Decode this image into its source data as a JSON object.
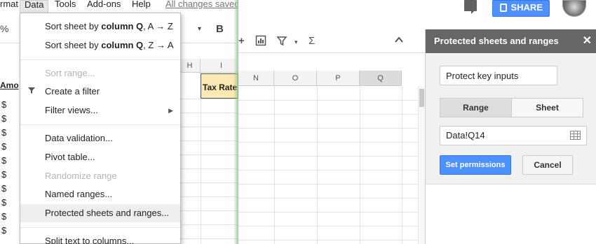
{
  "menubar": {
    "items": [
      "rmat",
      "Data",
      "Tools",
      "Add-ons",
      "Help"
    ],
    "saved_status": "All changes saved"
  },
  "toolbar_left": {
    "percent": "%",
    "dropdown_caret": "▾",
    "bold": "B"
  },
  "left_sheet": {
    "columns": [
      "H",
      "I"
    ],
    "amount_header": "Amo",
    "tax_rate_label": "Tax Rate",
    "dollar_cells": [
      "$",
      "$",
      "$",
      "$",
      "$",
      "$",
      "$",
      "$",
      "$",
      "$"
    ]
  },
  "data_menu": {
    "sort_az_prefix": "Sort sheet by ",
    "sort_az_bold": "column Q",
    "sort_az_suffix": ", A → Z",
    "sort_za_prefix": "Sort sheet by ",
    "sort_za_bold": "column Q",
    "sort_za_suffix": ", Z → A",
    "sort_range": "Sort range...",
    "create_filter": "Create a filter",
    "filter_views": "Filter views...",
    "data_validation": "Data validation...",
    "pivot_table": "Pivot table...",
    "randomize_range": "Randomize range",
    "named_ranges": "Named ranges...",
    "protected_sheets": "Protected sheets and ranges...",
    "split_text": "Split text to columns..."
  },
  "header_right": {
    "share_label": "SHARE"
  },
  "right_sheet": {
    "columns": [
      "N",
      "O",
      "P",
      "Q"
    ],
    "selected_column": "Q",
    "toolbar_icons": [
      "plus",
      "chart-icon",
      "filter-icon",
      "caret",
      "sigma-icon",
      "chevron-up-icon"
    ]
  },
  "protect_panel": {
    "title": "Protected sheets and ranges",
    "close": "✕",
    "description_value": "Protect key inputs",
    "tab_range": "Range",
    "tab_sheet": "Sheet",
    "range_value": "Data!Q14",
    "set_permissions": "Set permissions",
    "cancel": "Cancel"
  },
  "colors": {
    "accent": "#4d90fe",
    "panel_header": "#666666",
    "tax_rate_fill": "#fce8b2"
  }
}
